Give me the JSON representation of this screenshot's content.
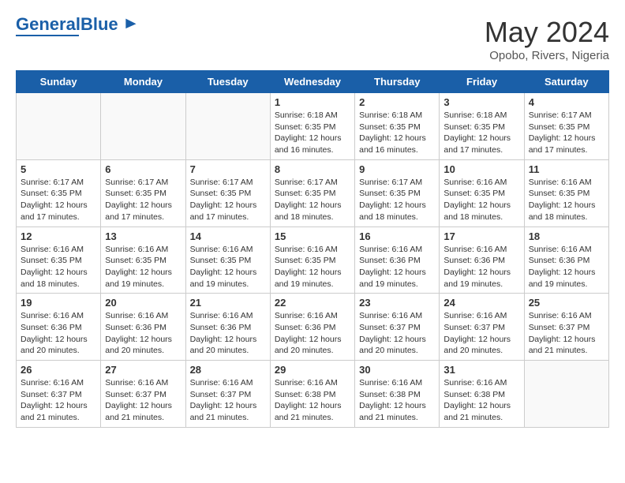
{
  "logo": {
    "text_general": "General",
    "text_blue": "Blue"
  },
  "header": {
    "month_year": "May 2024",
    "location": "Opobo, Rivers, Nigeria"
  },
  "weekdays": [
    "Sunday",
    "Monday",
    "Tuesday",
    "Wednesday",
    "Thursday",
    "Friday",
    "Saturday"
  ],
  "weeks": [
    [
      {
        "day": "",
        "sunrise": "",
        "sunset": "",
        "daylight": "",
        "empty": true
      },
      {
        "day": "",
        "sunrise": "",
        "sunset": "",
        "daylight": "",
        "empty": true
      },
      {
        "day": "",
        "sunrise": "",
        "sunset": "",
        "daylight": "",
        "empty": true
      },
      {
        "day": "1",
        "sunrise": "Sunrise: 6:18 AM",
        "sunset": "Sunset: 6:35 PM",
        "daylight": "Daylight: 12 hours and 16 minutes.",
        "empty": false
      },
      {
        "day": "2",
        "sunrise": "Sunrise: 6:18 AM",
        "sunset": "Sunset: 6:35 PM",
        "daylight": "Daylight: 12 hours and 16 minutes.",
        "empty": false
      },
      {
        "day": "3",
        "sunrise": "Sunrise: 6:18 AM",
        "sunset": "Sunset: 6:35 PM",
        "daylight": "Daylight: 12 hours and 17 minutes.",
        "empty": false
      },
      {
        "day": "4",
        "sunrise": "Sunrise: 6:17 AM",
        "sunset": "Sunset: 6:35 PM",
        "daylight": "Daylight: 12 hours and 17 minutes.",
        "empty": false
      }
    ],
    [
      {
        "day": "5",
        "sunrise": "Sunrise: 6:17 AM",
        "sunset": "Sunset: 6:35 PM",
        "daylight": "Daylight: 12 hours and 17 minutes.",
        "empty": false
      },
      {
        "day": "6",
        "sunrise": "Sunrise: 6:17 AM",
        "sunset": "Sunset: 6:35 PM",
        "daylight": "Daylight: 12 hours and 17 minutes.",
        "empty": false
      },
      {
        "day": "7",
        "sunrise": "Sunrise: 6:17 AM",
        "sunset": "Sunset: 6:35 PM",
        "daylight": "Daylight: 12 hours and 17 minutes.",
        "empty": false
      },
      {
        "day": "8",
        "sunrise": "Sunrise: 6:17 AM",
        "sunset": "Sunset: 6:35 PM",
        "daylight": "Daylight: 12 hours and 18 minutes.",
        "empty": false
      },
      {
        "day": "9",
        "sunrise": "Sunrise: 6:17 AM",
        "sunset": "Sunset: 6:35 PM",
        "daylight": "Daylight: 12 hours and 18 minutes.",
        "empty": false
      },
      {
        "day": "10",
        "sunrise": "Sunrise: 6:16 AM",
        "sunset": "Sunset: 6:35 PM",
        "daylight": "Daylight: 12 hours and 18 minutes.",
        "empty": false
      },
      {
        "day": "11",
        "sunrise": "Sunrise: 6:16 AM",
        "sunset": "Sunset: 6:35 PM",
        "daylight": "Daylight: 12 hours and 18 minutes.",
        "empty": false
      }
    ],
    [
      {
        "day": "12",
        "sunrise": "Sunrise: 6:16 AM",
        "sunset": "Sunset: 6:35 PM",
        "daylight": "Daylight: 12 hours and 18 minutes.",
        "empty": false
      },
      {
        "day": "13",
        "sunrise": "Sunrise: 6:16 AM",
        "sunset": "Sunset: 6:35 PM",
        "daylight": "Daylight: 12 hours and 19 minutes.",
        "empty": false
      },
      {
        "day": "14",
        "sunrise": "Sunrise: 6:16 AM",
        "sunset": "Sunset: 6:35 PM",
        "daylight": "Daylight: 12 hours and 19 minutes.",
        "empty": false
      },
      {
        "day": "15",
        "sunrise": "Sunrise: 6:16 AM",
        "sunset": "Sunset: 6:35 PM",
        "daylight": "Daylight: 12 hours and 19 minutes.",
        "empty": false
      },
      {
        "day": "16",
        "sunrise": "Sunrise: 6:16 AM",
        "sunset": "Sunset: 6:36 PM",
        "daylight": "Daylight: 12 hours and 19 minutes.",
        "empty": false
      },
      {
        "day": "17",
        "sunrise": "Sunrise: 6:16 AM",
        "sunset": "Sunset: 6:36 PM",
        "daylight": "Daylight: 12 hours and 19 minutes.",
        "empty": false
      },
      {
        "day": "18",
        "sunrise": "Sunrise: 6:16 AM",
        "sunset": "Sunset: 6:36 PM",
        "daylight": "Daylight: 12 hours and 19 minutes.",
        "empty": false
      }
    ],
    [
      {
        "day": "19",
        "sunrise": "Sunrise: 6:16 AM",
        "sunset": "Sunset: 6:36 PM",
        "daylight": "Daylight: 12 hours and 20 minutes.",
        "empty": false
      },
      {
        "day": "20",
        "sunrise": "Sunrise: 6:16 AM",
        "sunset": "Sunset: 6:36 PM",
        "daylight": "Daylight: 12 hours and 20 minutes.",
        "empty": false
      },
      {
        "day": "21",
        "sunrise": "Sunrise: 6:16 AM",
        "sunset": "Sunset: 6:36 PM",
        "daylight": "Daylight: 12 hours and 20 minutes.",
        "empty": false
      },
      {
        "day": "22",
        "sunrise": "Sunrise: 6:16 AM",
        "sunset": "Sunset: 6:36 PM",
        "daylight": "Daylight: 12 hours and 20 minutes.",
        "empty": false
      },
      {
        "day": "23",
        "sunrise": "Sunrise: 6:16 AM",
        "sunset": "Sunset: 6:37 PM",
        "daylight": "Daylight: 12 hours and 20 minutes.",
        "empty": false
      },
      {
        "day": "24",
        "sunrise": "Sunrise: 6:16 AM",
        "sunset": "Sunset: 6:37 PM",
        "daylight": "Daylight: 12 hours and 20 minutes.",
        "empty": false
      },
      {
        "day": "25",
        "sunrise": "Sunrise: 6:16 AM",
        "sunset": "Sunset: 6:37 PM",
        "daylight": "Daylight: 12 hours and 21 minutes.",
        "empty": false
      }
    ],
    [
      {
        "day": "26",
        "sunrise": "Sunrise: 6:16 AM",
        "sunset": "Sunset: 6:37 PM",
        "daylight": "Daylight: 12 hours and 21 minutes.",
        "empty": false
      },
      {
        "day": "27",
        "sunrise": "Sunrise: 6:16 AM",
        "sunset": "Sunset: 6:37 PM",
        "daylight": "Daylight: 12 hours and 21 minutes.",
        "empty": false
      },
      {
        "day": "28",
        "sunrise": "Sunrise: 6:16 AM",
        "sunset": "Sunset: 6:37 PM",
        "daylight": "Daylight: 12 hours and 21 minutes.",
        "empty": false
      },
      {
        "day": "29",
        "sunrise": "Sunrise: 6:16 AM",
        "sunset": "Sunset: 6:38 PM",
        "daylight": "Daylight: 12 hours and 21 minutes.",
        "empty": false
      },
      {
        "day": "30",
        "sunrise": "Sunrise: 6:16 AM",
        "sunset": "Sunset: 6:38 PM",
        "daylight": "Daylight: 12 hours and 21 minutes.",
        "empty": false
      },
      {
        "day": "31",
        "sunrise": "Sunrise: 6:16 AM",
        "sunset": "Sunset: 6:38 PM",
        "daylight": "Daylight: 12 hours and 21 minutes.",
        "empty": false
      },
      {
        "day": "",
        "sunrise": "",
        "sunset": "",
        "daylight": "",
        "empty": true
      }
    ]
  ]
}
